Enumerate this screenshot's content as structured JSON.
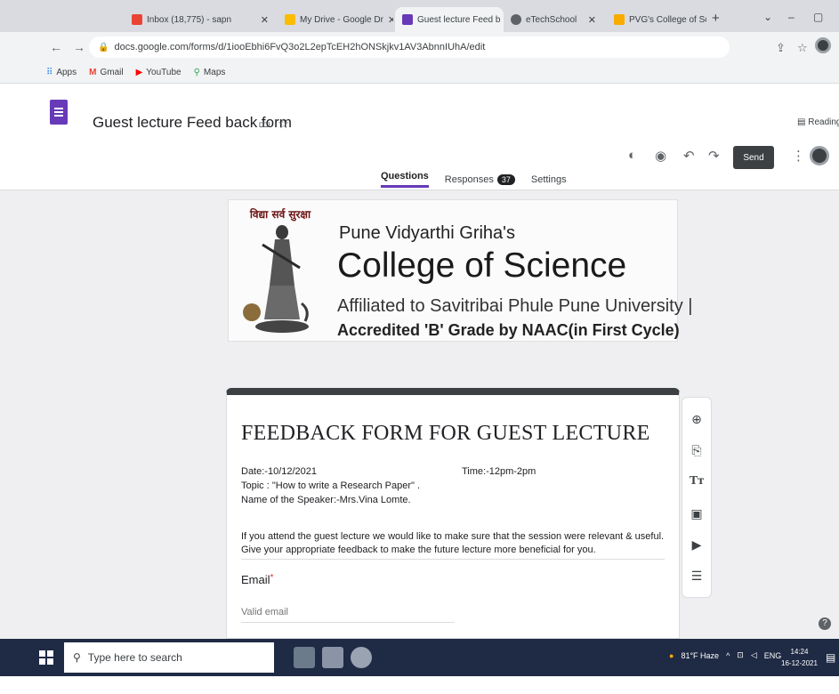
{
  "browser": {
    "tabs": [
      {
        "label": "Inbox (18,775) - sapn",
        "icon": "gmail-icon"
      },
      {
        "label": "My Drive - Google Dr",
        "icon": "drive-icon"
      },
      {
        "label": "Guest lecture Feed b",
        "icon": "forms-icon",
        "active": true
      },
      {
        "label": "eTechSchool",
        "icon": "globe-icon"
      },
      {
        "label": "PVG's College of Scie",
        "icon": "page-icon"
      }
    ],
    "url": "docs.google.com/forms/d/1iooEbhi6FvQ3o2L2epTcEH2hONSkjkv1AV3AbnnIUhA/edit",
    "bookmarks": [
      {
        "label": "Apps",
        "icon": "apps-grid-icon"
      },
      {
        "label": "Gmail",
        "icon": "gmail-icon"
      },
      {
        "label": "YouTube",
        "icon": "youtube-icon"
      },
      {
        "label": "Maps",
        "icon": "maps-pin-icon"
      }
    ],
    "reading_list": "Reading lis"
  },
  "forms": {
    "doc_title": "Guest lecture Feed back form",
    "send_label": "Send",
    "tabs": {
      "questions": "Questions",
      "responses": "Responses",
      "settings": "Settings"
    },
    "responses_count": "37"
  },
  "banner": {
    "line1": "Pune Vidyarthi Griha's",
    "line2": "College of Science",
    "line3": "Affiliated to Savitribai Phule Pune University |",
    "line4": "Accredited 'B' Grade by NAAC(in First Cycle)",
    "logo_text": "विद्या सर्व सुरक्षा"
  },
  "form": {
    "title": "FEEDBACK FORM FOR GUEST LECTURE",
    "date": "Date:-10/12/2021",
    "time": "Time:-12pm-2pm",
    "topic": "Topic : \"How to write a Research Paper\" .",
    "speaker": "Name of the Speaker:-Mrs.Vina Lomte.",
    "description": "If you attend the guest lecture we would like to make sure that the session were relevant & useful. Give your appropriate feedback to make the future lecture more beneficial for you.",
    "email_label": "Email",
    "required_mark": "*",
    "email_placeholder": "Valid email"
  },
  "taskbar": {
    "search_placeholder": "Type here to search",
    "weather": "81°F Haze",
    "lang": "ENG",
    "time": "14:24",
    "date": "16-12-2021"
  }
}
